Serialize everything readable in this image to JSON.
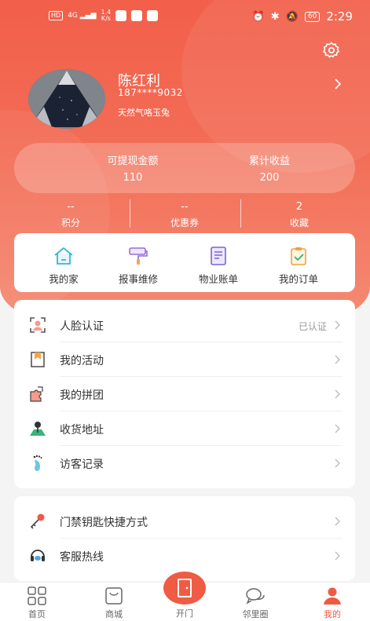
{
  "status_bar": {
    "hd": "HD",
    "signal": "4G",
    "speed": "1.4",
    "speed_unit": "K/s",
    "battery": "60",
    "time": "2:29"
  },
  "profile": {
    "name": "陈红利",
    "phone": "187****9032",
    "signature": "天然气咯玉兔"
  },
  "balance": {
    "withdrawable_label": "可提现金额",
    "withdrawable_value": "110",
    "earnings_label": "累计收益",
    "earnings_value": "200"
  },
  "stats": [
    {
      "value": "--",
      "label": "积分"
    },
    {
      "value": "--",
      "label": "优惠券"
    },
    {
      "value": "2",
      "label": "收藏"
    }
  ],
  "quick_actions": [
    {
      "label": "我的家",
      "icon": "home-icon"
    },
    {
      "label": "报事维修",
      "icon": "paint-roller-icon"
    },
    {
      "label": "物业账单",
      "icon": "bill-icon"
    },
    {
      "label": "我的订单",
      "icon": "order-icon"
    }
  ],
  "menu_group_1": [
    {
      "label": "人脸认证",
      "status": "已认证",
      "icon": "face-scan-icon"
    },
    {
      "label": "我的活动",
      "status": "",
      "icon": "activity-flag-icon"
    },
    {
      "label": "我的拼团",
      "status": "",
      "icon": "puzzle-icon"
    },
    {
      "label": "收货地址",
      "status": "",
      "icon": "map-pin-icon"
    },
    {
      "label": "访客记录",
      "status": "",
      "icon": "footprint-icon"
    }
  ],
  "menu_group_2": [
    {
      "label": "门禁钥匙快捷方式",
      "icon": "key-icon"
    },
    {
      "label": "客服热线",
      "icon": "headset-icon"
    }
  ],
  "bottom_nav": [
    {
      "label": "首页",
      "icon": "grid-icon"
    },
    {
      "label": "商城",
      "icon": "basket-icon"
    },
    {
      "label": "开门",
      "icon": "door-icon"
    },
    {
      "label": "邻里圈",
      "icon": "chat-bubbles-icon"
    },
    {
      "label": "我的",
      "icon": "user-icon",
      "active": true
    }
  ],
  "colors": {
    "brand": "#f05b43",
    "header_gradient_start": "#f25f4a",
    "header_gradient_end": "#f48a73"
  }
}
